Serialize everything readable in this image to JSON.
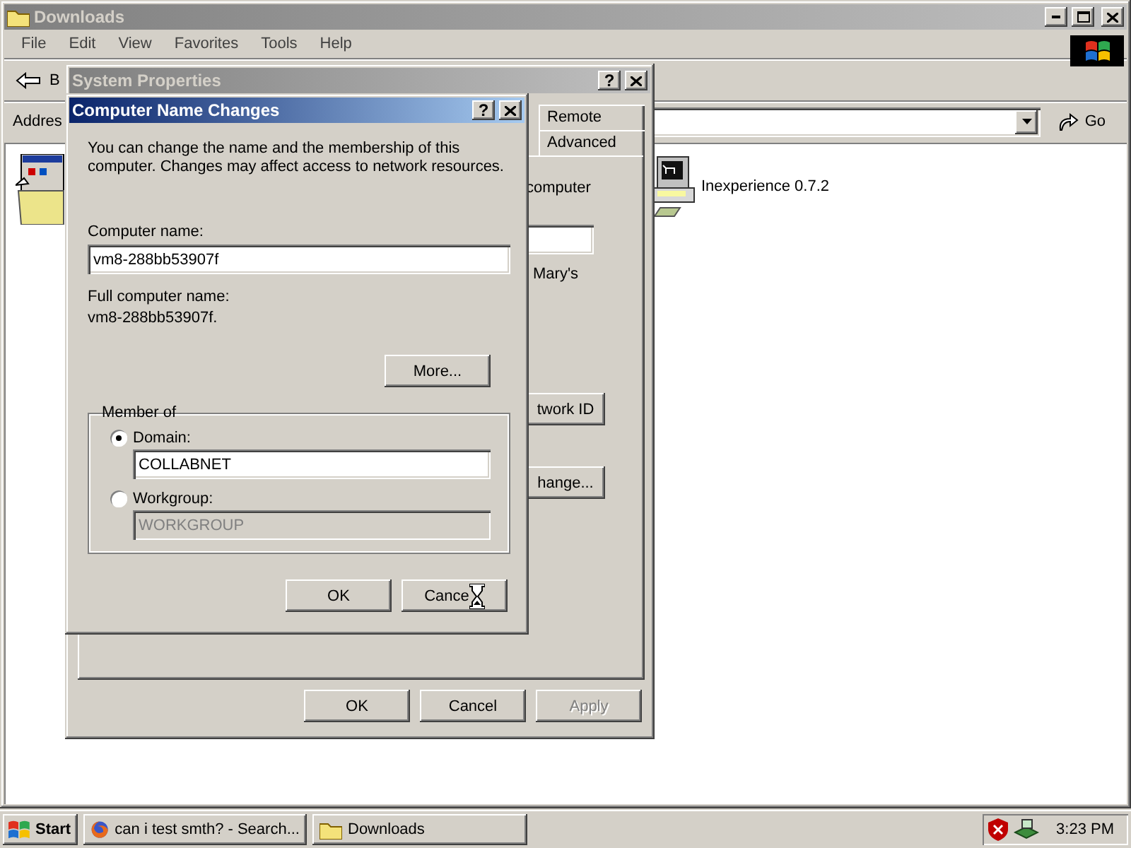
{
  "explorer": {
    "title": "Downloads",
    "menu": [
      "File",
      "Edit",
      "View",
      "Favorites",
      "Tools",
      "Help"
    ],
    "back_label": "B",
    "address_label": "Addres",
    "go_label": "Go",
    "items": [
      {
        "kind": "program",
        "label": "Inexperience 0.7.2"
      }
    ]
  },
  "system_properties": {
    "title": "System Properties",
    "help_glyph": "?",
    "tabs": [
      {
        "label": "Remote",
        "selected": false
      },
      {
        "label": "Advanced",
        "selected": false
      }
    ],
    "texts": [
      "computer",
      "Mary's"
    ],
    "buttons": [
      "twork ID",
      "hange..."
    ],
    "footer_buttons": [
      {
        "label": "OK",
        "disabled": false
      },
      {
        "label": "Cancel",
        "disabled": false
      },
      {
        "label": "Apply",
        "disabled": true
      }
    ]
  },
  "dialog": {
    "title": "Computer Name Changes",
    "help_glyph": "?",
    "intro": "You can change the name and the membership of this computer. Changes may affect access to network resources.",
    "computer_name_label": "Computer name:",
    "computer_name": "vm8-288bb53907f",
    "full_name_label": "Full computer name:",
    "full_name": "vm8-288bb53907f.",
    "more_button": "More...",
    "member_of": {
      "legend": "Member of",
      "options": [
        {
          "label": "Domain:",
          "selected": true,
          "value": "COLLABNET",
          "disabled": false
        },
        {
          "label": "Workgroup:",
          "selected": false,
          "value": "WORKGROUP",
          "disabled": true
        }
      ]
    },
    "buttons": [
      "OK",
      "Cance"
    ]
  },
  "taskbar": {
    "start": "Start",
    "tasks": [
      {
        "label": "can i test smth? - Search...",
        "kind": "browser"
      },
      {
        "label": "Downloads",
        "kind": "folder"
      }
    ],
    "clock": "3:23 PM"
  }
}
